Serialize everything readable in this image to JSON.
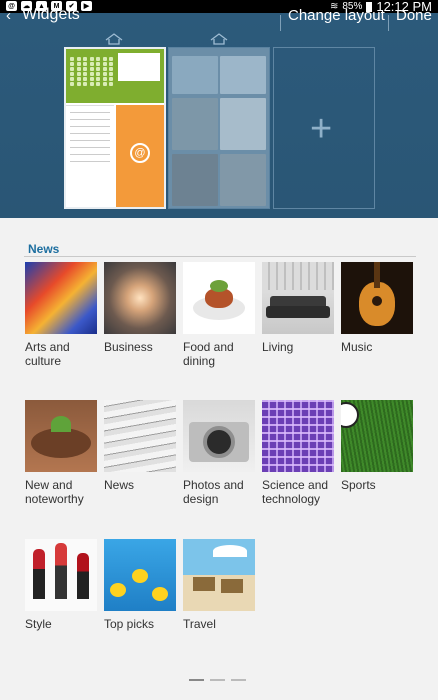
{
  "status_bar": {
    "battery": "85%",
    "time": "12:12 PM",
    "left_icons": [
      "sync-icon",
      "cloud-icon",
      "image-icon",
      "mail-icon",
      "check-icon",
      "youtube-icon"
    ]
  },
  "action_bar": {
    "title": "Widgets",
    "change_layout_label": "Change layout",
    "done_label": "Done"
  },
  "home_pages": {
    "count": 3,
    "add_page_symbol": "+",
    "accent_colors": {
      "calendar": "#7fae2f",
      "email": "#f39a3a",
      "panel": "#2c5a7b"
    }
  },
  "section": {
    "title": "News",
    "categories": [
      {
        "label_line1": "Arts and",
        "label_line2": "culture",
        "image": "colorful-abstract"
      },
      {
        "label_line1": "Business",
        "label_line2": "",
        "image": "skyscrapers"
      },
      {
        "label_line1": "Food and",
        "label_line2": "dining",
        "image": "plated-food"
      },
      {
        "label_line1": "Living",
        "label_line2": "",
        "image": "sofa-room"
      },
      {
        "label_line1": "Music",
        "label_line2": "",
        "image": "acoustic-guitar"
      },
      {
        "label_line1": "New and",
        "label_line2": "noteworthy",
        "image": "seedlings"
      },
      {
        "label_line1": "News",
        "label_line2": "",
        "image": "newspapers"
      },
      {
        "label_line1": "Photos and",
        "label_line2": "design",
        "image": "camera"
      },
      {
        "label_line1": "Science and",
        "label_line2": "technology",
        "image": "circuit-grid"
      },
      {
        "label_line1": "Sports",
        "label_line2": "",
        "image": "soccer-ball"
      },
      {
        "label_line1": "Style",
        "label_line2": "",
        "image": "lipsticks"
      },
      {
        "label_line1": "Top picks",
        "label_line2": "",
        "image": "rubber-ducks"
      },
      {
        "label_line1": "Travel",
        "label_line2": "",
        "image": "beach-chairs"
      }
    ]
  },
  "pager": {
    "pages": 3,
    "current": 1
  }
}
